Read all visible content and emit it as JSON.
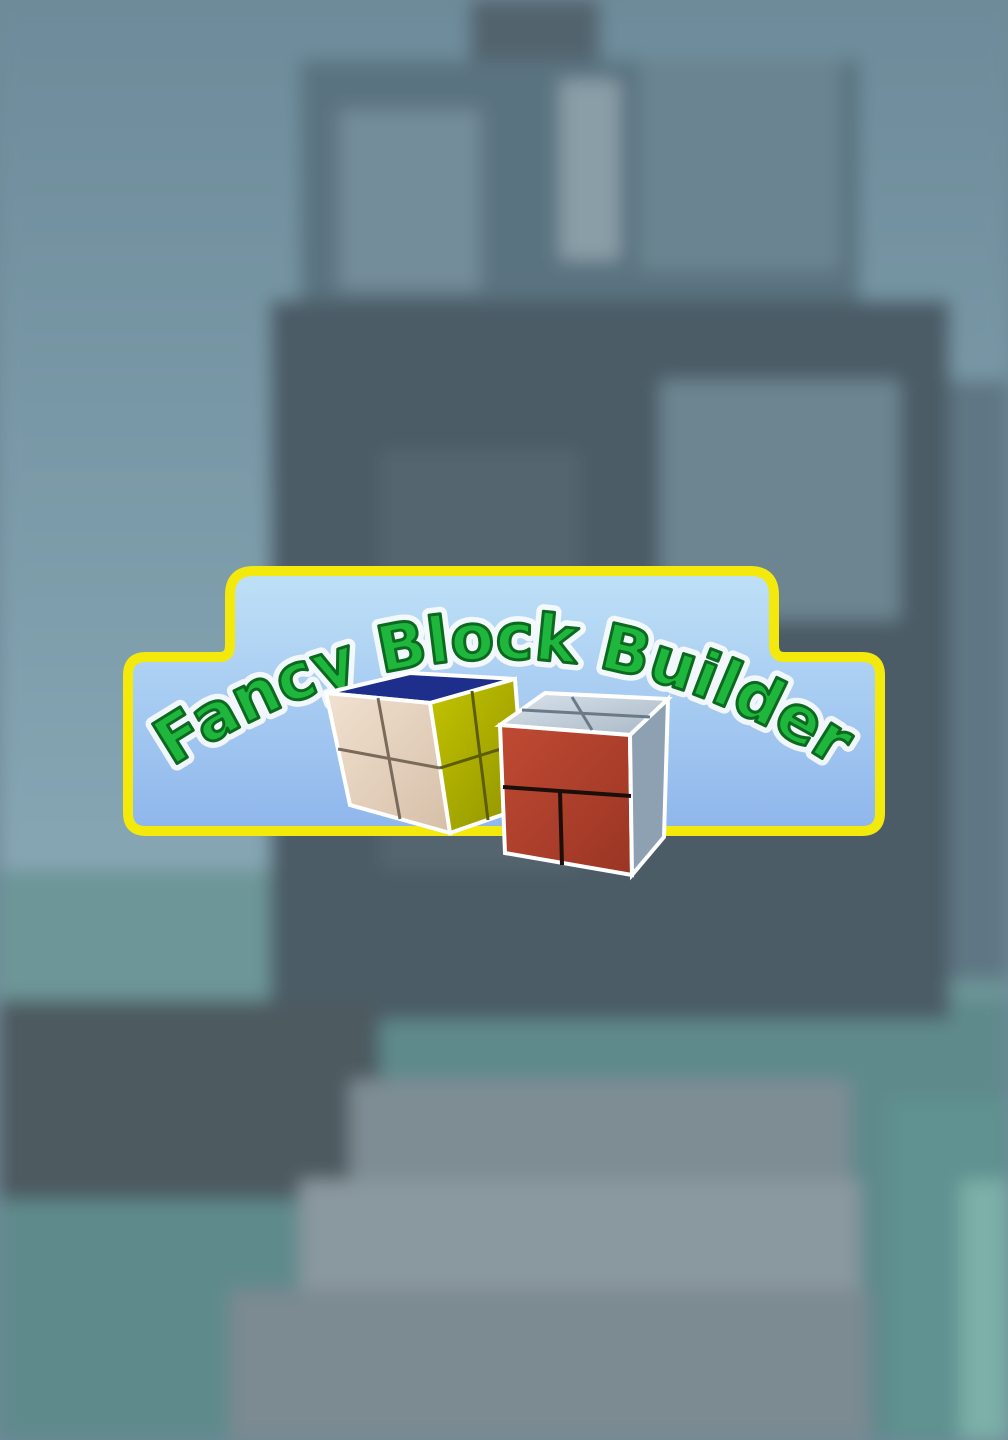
{
  "game_title": {
    "word1": "Fancy",
    "word2": "Block",
    "word3": "Builder"
  },
  "colors": {
    "sky_fog": "#7f9eae",
    "tower": "#52636d",
    "banner_fill": "#a9d1f1",
    "banner_border": "#f4e90d",
    "title_green": "#1eb63c",
    "title_outline": "#0b6a1e",
    "cube_wood": "#e8d6c4",
    "cube_yellow": "#b3b400",
    "cube_blue": "#1d2f8a",
    "cube_brick": "#b0402c",
    "cube_steel": "#c7d3de"
  },
  "icons": {
    "wood_cube": "cube-icon",
    "brick_cube": "brick-cube-icon"
  }
}
